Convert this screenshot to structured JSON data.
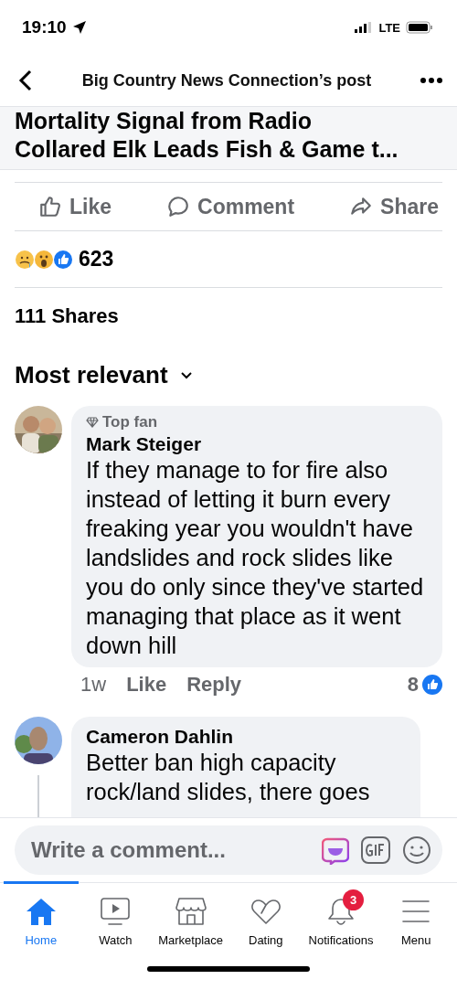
{
  "status_bar": {
    "time": "19:10",
    "network": "LTE"
  },
  "header": {
    "title": "Big Country News Connection’s post"
  },
  "headline": [
    "Mortality Signal from Radio",
    "Collared Elk Leads Fish & Game t..."
  ],
  "actions": [
    {
      "kind": "like",
      "label": "Like"
    },
    {
      "kind": "comment",
      "label": "Comment"
    },
    {
      "kind": "share",
      "label": "Share"
    }
  ],
  "reactions": {
    "count": "623"
  },
  "shares": "111 Shares",
  "sort": {
    "label": "Most relevant"
  },
  "comments": [
    {
      "badge": "Top fan",
      "author": "Mark Steiger",
      "text": "If they manage to for fire also instead of letting it burn every freaking year you wouldn't have landslides and rock slides like you do only since they've started managing that place as it went down hill",
      "time": "1w",
      "like": "Like",
      "reply": "Reply",
      "likes": "8",
      "thread": false
    },
    {
      "author": "Cameron Dahlin",
      "lines": [
        "Better ban high capacity",
        "rock/land slides, there goes"
      ],
      "thread": true
    }
  ],
  "composer": {
    "placeholder": "Write a comment..."
  },
  "tabs": [
    {
      "kind": "home",
      "label": "Home",
      "selected": true
    },
    {
      "kind": "watch",
      "label": "Watch",
      "selected": false
    },
    {
      "kind": "marketplace",
      "label": "Marketplace",
      "selected": false
    },
    {
      "kind": "dating",
      "label": "Dating",
      "selected": false
    },
    {
      "kind": "notifications",
      "label": "Notifications",
      "selected": false,
      "badge": "3"
    },
    {
      "kind": "menu",
      "label": "Menu",
      "selected": false
    }
  ]
}
